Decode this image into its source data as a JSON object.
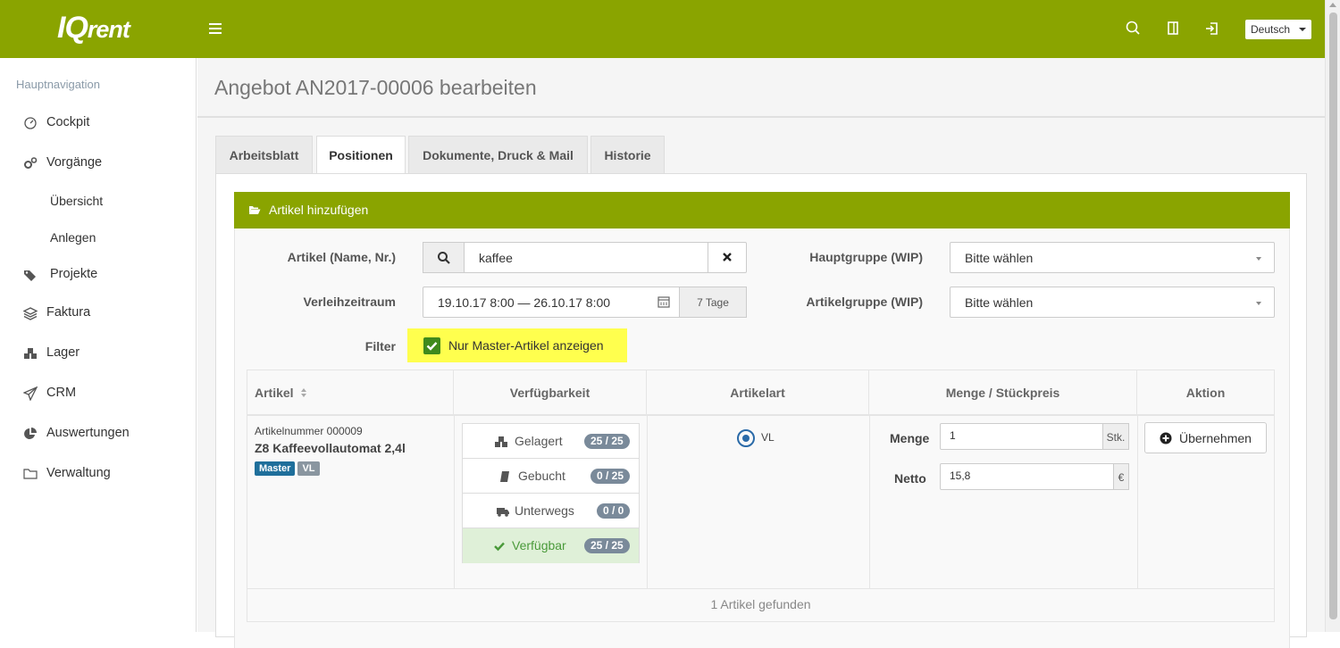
{
  "app": {
    "logo_main": "IQ",
    "logo_rest": "rent"
  },
  "topbar": {
    "language": "Deutsch"
  },
  "sidebar": {
    "title": "Hauptnavigation",
    "items": [
      {
        "label": "Cockpit",
        "icon": "dashboard-icon"
      },
      {
        "label": "Vorgänge",
        "icon": "gears-icon"
      },
      {
        "label": "Übersicht",
        "icon": ""
      },
      {
        "label": "Anlegen",
        "icon": ""
      },
      {
        "label": "Projekte",
        "icon": "tags-icon"
      },
      {
        "label": "Faktura",
        "icon": "layers-icon"
      },
      {
        "label": "Lager",
        "icon": "cubes-icon"
      },
      {
        "label": "CRM",
        "icon": "paper-plane-icon"
      },
      {
        "label": "Auswertungen",
        "icon": "pie-chart-icon"
      },
      {
        "label": "Verwaltung",
        "icon": "folder-icon"
      }
    ]
  },
  "page": {
    "title": "Angebot AN2017-00006 bearbeiten"
  },
  "tabs": [
    {
      "label": "Arbeitsblatt"
    },
    {
      "label": "Positionen"
    },
    {
      "label": "Dokumente, Druck & Mail"
    },
    {
      "label": "Historie"
    }
  ],
  "panel": {
    "title": "Artikel hinzufügen"
  },
  "form": {
    "article_label": "Artikel (Name, Nr.)",
    "article_value": "kaffee",
    "period_label": "Verleihzeitraum",
    "period_value": "19.10.17 8:00 — 26.10.17 8:00",
    "period_days": "7 Tage",
    "filter_label": "Filter",
    "filter_text": "Nur Master-Artikel anzeigen",
    "main_group_label": "Hauptgruppe (WIP)",
    "main_group_value": "Bitte wählen",
    "article_group_label": "Artikelgruppe (WIP)",
    "article_group_value": "Bitte wählen"
  },
  "table": {
    "headers": [
      "Artikel",
      "Verfügbarkeit",
      "Artikelart",
      "Menge / Stückpreis",
      "Aktion"
    ],
    "row": {
      "article_number": "Artikelnummer 000009",
      "article_name": "Z8 Kaffeevollautomat 2,4l",
      "badges": [
        "Master",
        "VL"
      ],
      "availability": [
        {
          "label": "Gelagert",
          "count": "25 / 25"
        },
        {
          "label": "Gebucht",
          "count": "0 / 25"
        },
        {
          "label": "Unterwegs",
          "count": "0 / 0"
        },
        {
          "label": "Verfügbar",
          "count": "25 / 25"
        }
      ],
      "type": "VL",
      "quantity_label": "Menge",
      "quantity_value": "1",
      "quantity_unit": "Stk.",
      "net_label": "Netto",
      "net_value": "15,8",
      "net_unit": "€",
      "action": "Übernehmen"
    },
    "footer": "1 Artikel gefunden"
  },
  "colors": {
    "brand": "#8aa400",
    "highlight": "#ffff4e",
    "badge_master": "#1f6f9b",
    "badge_vl": "#8a96a0"
  }
}
